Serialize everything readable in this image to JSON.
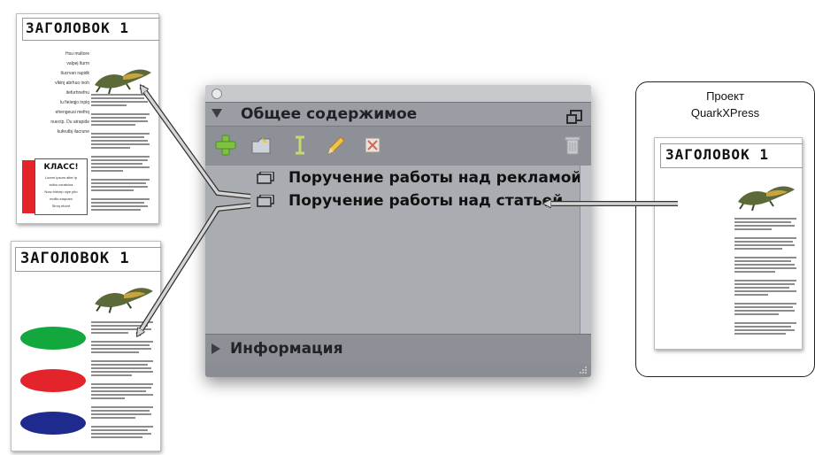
{
  "documents": {
    "top_left": {
      "heading": "ЗАГОЛОВОК 1",
      "right_rail": [
        "Hsu multore",
        "valpej lturm",
        "tlucrvan rapidk",
        "vlkinj abrhuo inoh",
        "itefurhnefnu",
        "lu fieleqjo inpiq",
        "ehengeusi mefnq",
        "nuectp. Du atrapide",
        "kufeutbj ilacrune"
      ],
      "sidebar_title": "КЛАСС!",
      "sidebar_lines": [
        "Lorem ipsum alter ip",
        "scibu coratcioa",
        "Now tridvep ulye ptio",
        "mollis eaquam",
        "Slmq eturnt"
      ]
    },
    "bottom_left": {
      "heading": "ЗАГОЛОВОК 1",
      "oval_colors": [
        "#13a83e",
        "#e3242b",
        "#1f2a8f"
      ]
    },
    "project": {
      "title_line1": "Проект",
      "title_line2": "QuarkXPress",
      "heading": "ЗАГОЛОВОК 1"
    }
  },
  "palette": {
    "section_title": "Общее содержимое",
    "tools": [
      "add-icon",
      "folder-icon",
      "text-cursor-icon",
      "pencil-icon",
      "image-icon",
      "trash-icon"
    ],
    "items": [
      {
        "label": "Поручение работы над рекламой"
      },
      {
        "label": "Поручение работы над статьей"
      }
    ],
    "info_title": "Информация"
  },
  "colors": {
    "palette_bg": "#8a8e94",
    "list_bg": "#a9acb1",
    "accent_red": "#e3242b",
    "arrow_fill": "#d4d4d4"
  }
}
